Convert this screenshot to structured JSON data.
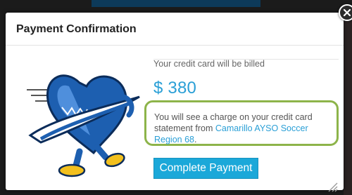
{
  "dialog": {
    "title": "Payment Confirmation",
    "billed_label": "Your credit card will be billed",
    "amount": "$ 380",
    "notice_prefix": "You will see a charge on your credit card statement from ",
    "notice_org": "Camarillo AYSO Soccer Region 68",
    "notice_suffix": ".",
    "pay_button_label": "Complete Payment"
  },
  "icons": {
    "close": "close-icon",
    "mascot": "ayso-mascot-icon",
    "resize": "resize-grip-icon"
  },
  "colors": {
    "accent_blue": "#2a9fd6",
    "button_blue": "#1ba8d9",
    "highlight_green": "#8db44a"
  }
}
